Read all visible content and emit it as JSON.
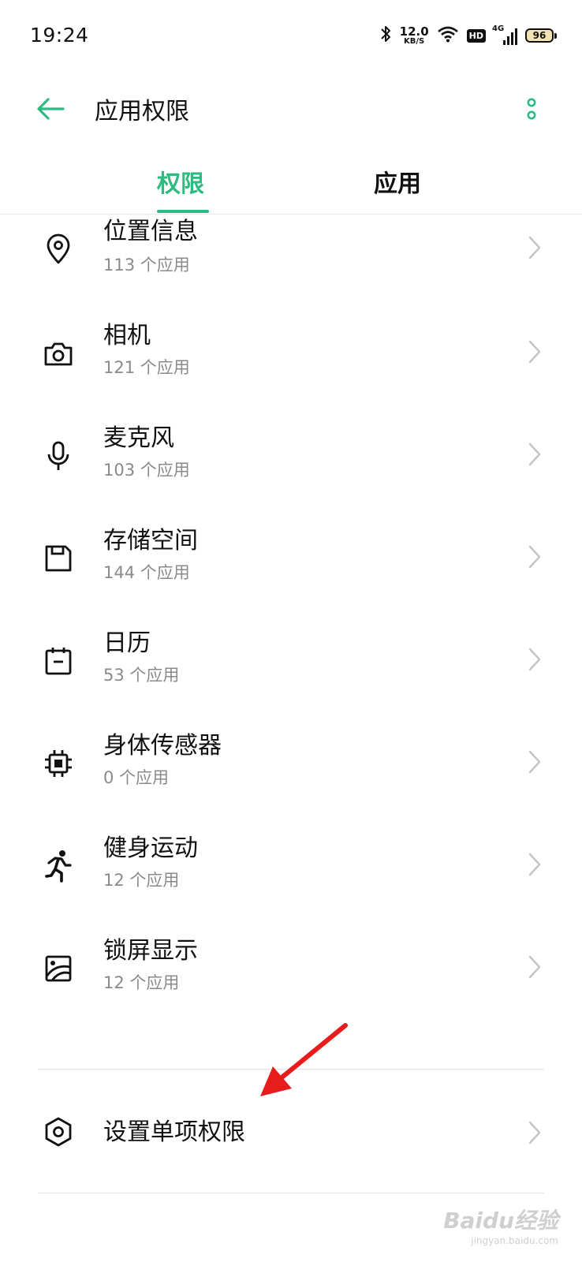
{
  "status_bar": {
    "time": "19:24",
    "net_speed_value": "12.0",
    "net_speed_unit": "KB/S",
    "hd_badge": "HD",
    "network_type": "4G",
    "battery": "96"
  },
  "header": {
    "title": "应用权限"
  },
  "tabs": [
    {
      "label": "权限",
      "active": true
    },
    {
      "label": "应用",
      "active": false
    }
  ],
  "permissions": [
    {
      "name": "位置信息",
      "count": "113 个应用",
      "icon": "location-icon"
    },
    {
      "name": "相机",
      "count": "121 个应用",
      "icon": "camera-icon"
    },
    {
      "name": "麦克风",
      "count": "103 个应用",
      "icon": "microphone-icon"
    },
    {
      "name": "存储空间",
      "count": "144 个应用",
      "icon": "storage-icon"
    },
    {
      "name": "日历",
      "count": "53 个应用",
      "icon": "calendar-icon"
    },
    {
      "name": "身体传感器",
      "count": "0 个应用",
      "icon": "body-sensor-icon"
    },
    {
      "name": "健身运动",
      "count": "12 个应用",
      "icon": "fitness-icon"
    },
    {
      "name": "锁屏显示",
      "count": "12 个应用",
      "icon": "lockscreen-display-icon"
    }
  ],
  "single_permission": {
    "label": "设置单项权限",
    "icon": "hexagon-settings-icon"
  },
  "watermark": {
    "main": "Baidu经验",
    "sub": "jingyan.baidu.com"
  },
  "colors": {
    "accent": "#2dbb82",
    "annotation_arrow": "#e81c1c",
    "secondary_text": "#8a8a8a"
  }
}
